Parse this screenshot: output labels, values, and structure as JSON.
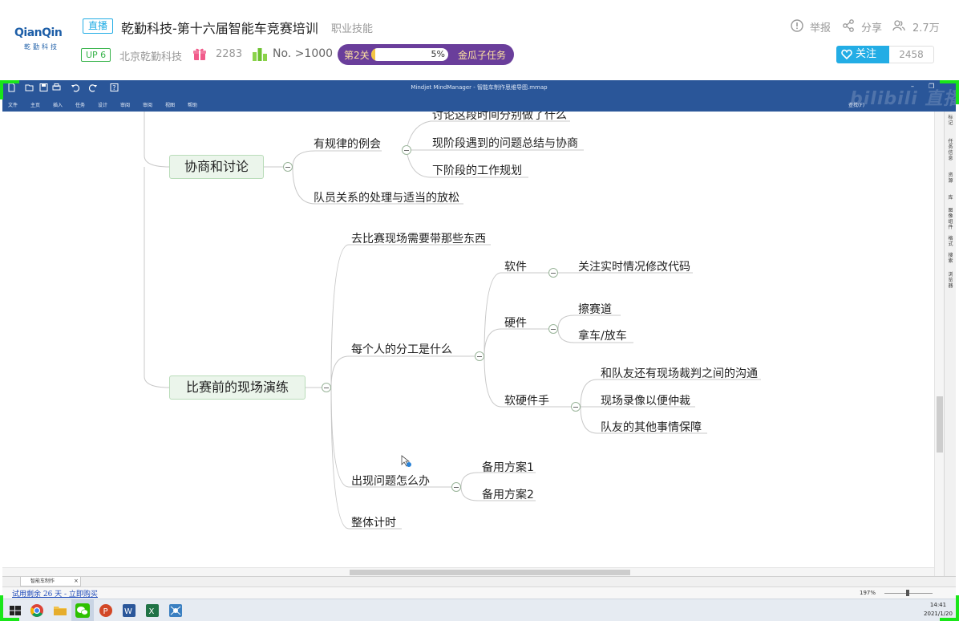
{
  "header": {
    "logo_line1": "QianQin",
    "logo_line2": "乾勤科技",
    "live_tag": "直播",
    "title": "乾勤科技-第十六届智能车竞赛培训",
    "category": "职业技能",
    "up_level": "UP 6",
    "up_name": "北京乾勤科技",
    "gift_count": "2283",
    "rank": "No. >1000",
    "task_level": "第2关",
    "task_percent": "5%",
    "task_progress": 0.05,
    "task_name": "金瓜子任务",
    "report": "举报",
    "share": "分享",
    "viewers": "2.7万",
    "follow_label": "关注",
    "fans": "2458"
  },
  "mindmanager": {
    "window_title": "Mindjet MindManager - 智能车制作思维导图.mmap",
    "menu": [
      "文件",
      "主页",
      "插入",
      "任务",
      "设计",
      "审阅",
      "审阅",
      "视图",
      "帮助"
    ],
    "search_label": "查找(F)",
    "watermark": "bilibili 直播",
    "right_panel": [
      "标记",
      "任务信息",
      "资源",
      "库",
      "图像组件",
      "格式",
      "搜索",
      "浏览器"
    ],
    "doc_tab": "智能车制作",
    "trial_notice": "试用剩余 26 天 - 立即购买",
    "zoom": "197%"
  },
  "map": {
    "node_negotiate": {
      "label": "协商和讨论",
      "children": [
        {
          "label": "有规律的例会",
          "children": [
            "讨论这段时间分别做了什么",
            "现阶段遇到的问题总结与协商",
            "下阶段的工作规划"
          ]
        },
        {
          "label": "队员关系的处理与适当的放松"
        }
      ]
    },
    "node_rehearsal": {
      "label": "比赛前的现场演练",
      "children": [
        {
          "label": "去比赛现场需要带那些东西"
        },
        {
          "label": "每个人的分工是什么",
          "children": [
            {
              "label": "软件",
              "children": [
                "关注实时情况修改代码"
              ]
            },
            {
              "label": "硬件",
              "children": [
                "擦赛道",
                "拿车/放车"
              ]
            },
            {
              "label": "软硬件手",
              "children": [
                "和队友还有现场裁判之间的沟通",
                "现场录像以便仲裁",
                "队友的其他事情保障"
              ]
            }
          ]
        },
        {
          "label": "出现问题怎么办",
          "children": [
            "备用方案1",
            "备用方案2"
          ]
        },
        {
          "label": "整体计时"
        }
      ]
    }
  },
  "taskbar": {
    "time": "14:41",
    "date": "2021/1/20"
  },
  "colors": {
    "bili_blue": "#23ade5",
    "mm_blue": "#2a5699",
    "node_green": "#ebf5eb",
    "task_purple": "#6a3e9b",
    "frame_green": "#19e619"
  }
}
